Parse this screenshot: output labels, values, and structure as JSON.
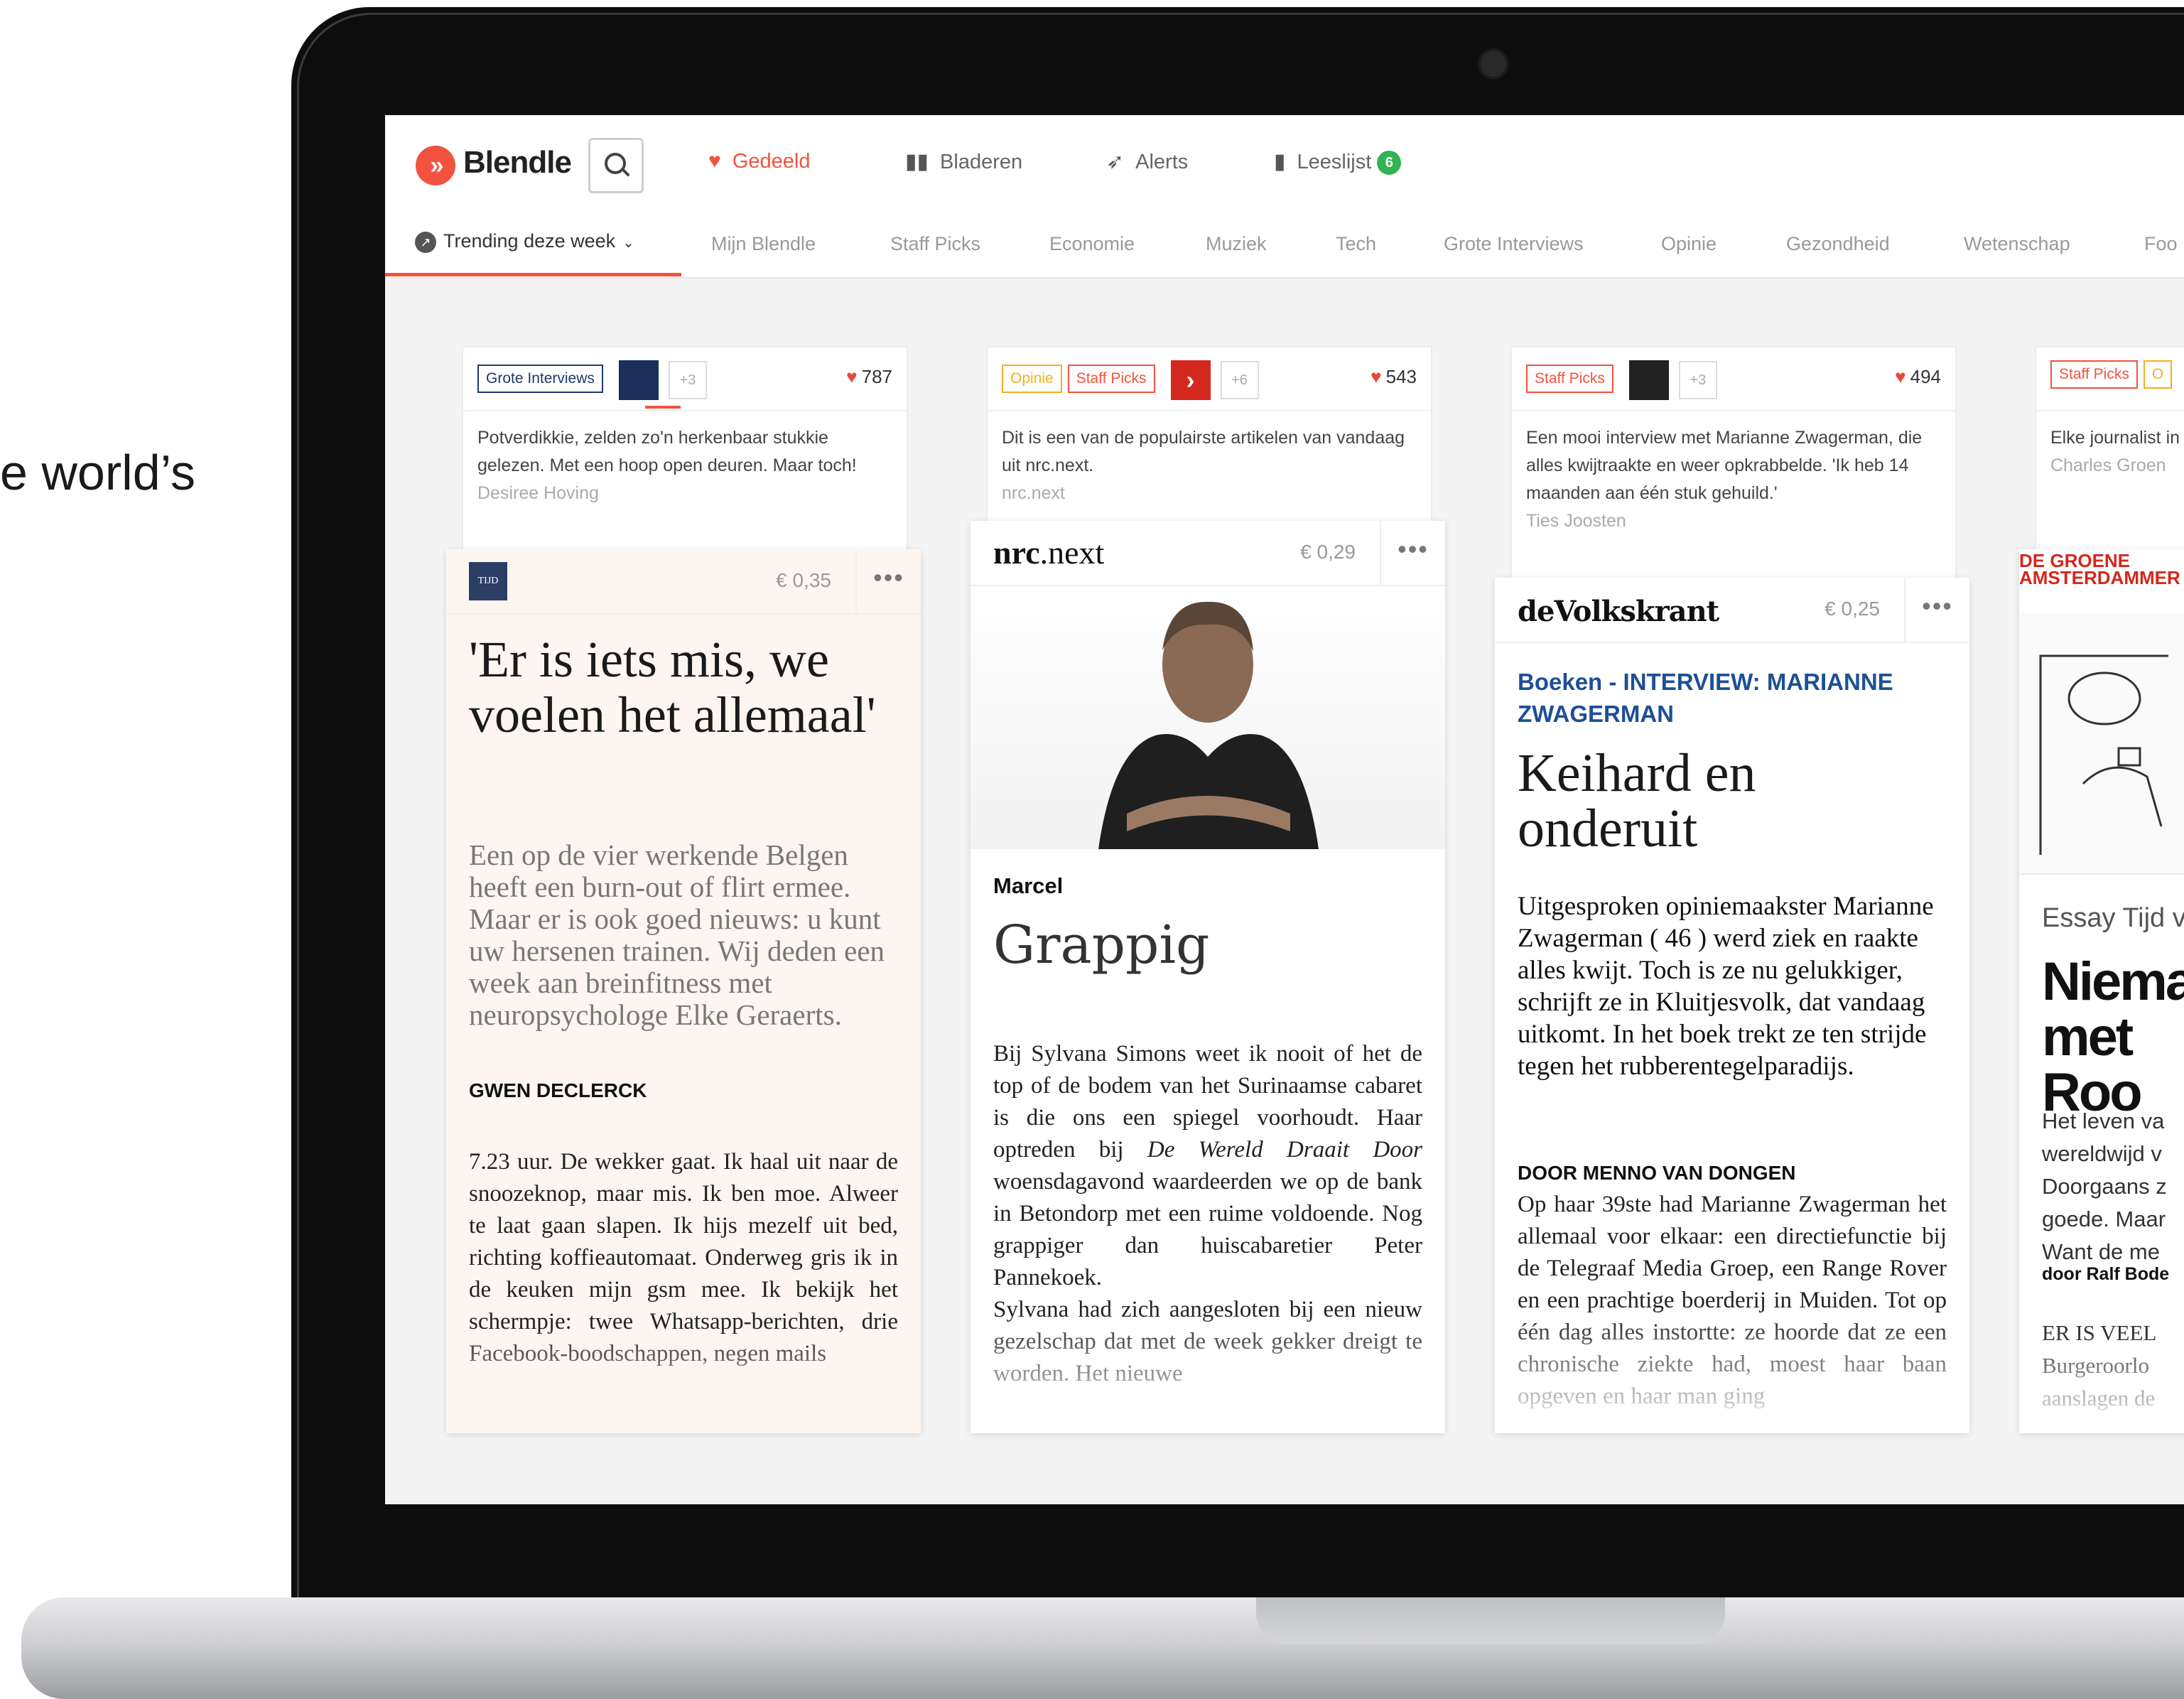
{
  "marketing": {
    "tagline_fragment": "e world’s"
  },
  "app": {
    "logo_text": "Blendle",
    "nav": [
      {
        "label": "Gedeeld",
        "icon": "heart-icon"
      },
      {
        "label": "Bladeren",
        "icon": "book-icon"
      },
      {
        "label": "Alerts",
        "icon": "alert-icon"
      },
      {
        "label": "Leeslijst",
        "icon": "bookmark-icon",
        "badge": "6"
      }
    ],
    "subnav_active": "Trending deze week",
    "subnav": [
      "Mijn Blendle",
      "Staff Picks",
      "Economie",
      "Muziek",
      "Tech",
      "Grote Interviews",
      "Opinie",
      "Gezondheid",
      "Wetenschap",
      "Foo"
    ]
  },
  "cards": [
    {
      "tags": [
        "Grote Interviews"
      ],
      "plus": "+3",
      "likes": "787",
      "snippet": "Potverdikkie, zelden zo'n herkenbaar stukkie gelezen. Met een hoop open deuren. Maar toch!",
      "snippet_author": "Desiree Hoving",
      "publisher": "TIJD",
      "price": "€ 0,35",
      "title": "'Er is iets mis, we voelen het allemaal'",
      "lead": "Een op de vier werkende Belgen heeft een burn-out of flirt ermee. Maar er is ook goed nieuws: u kunt uw hersenen trainen. Wij deden een week aan breinfitness met neuropsychologe Elke Geraerts.",
      "byline": "GWEN DECLERCK",
      "body": "7.23 uur. De wekker gaat. Ik haal uit naar de snoozeknop, maar mis. Ik ben moe. Alweer te laat gaan slapen. Ik hijs mezelf uit bed, richting koffieautomaat. Onderweg gris ik in de keuken mijn gsm mee. Ik bekijk het schermpje: twee Whatsapp-berichten, drie Facebook-boodschappen, negen mails"
    },
    {
      "tags": [
        "Opinie",
        "Staff Picks"
      ],
      "plus": "+6",
      "likes": "543",
      "snippet": "Dit is een van de populairste artikelen van vandaag uit nrc.next.",
      "snippet_author": "nrc.next",
      "publisher_bold": "nrc",
      "publisher_rest": ".next",
      "price": "€ 0,29",
      "kicker": "Marcel",
      "title": "Grappig",
      "body1": "Bij Sylvana Simons weet ik nooit of het de top of de bodem van het Surinaamse cabaret is die ons een spiegel voorhoudt. Haar optreden bij",
      "body_italic": "De Wereld Draait Door",
      "body2": " woensdagavond waardeerden we op de bank in Betondorp met een ruime voldoende. Nog grappiger dan huiscabaretier Peter Pannekoek.",
      "body3": "Sylvana had zich aangesloten bij een nieuw gezelschap dat met de week gekker dreigt te worden. Het nieuwe"
    },
    {
      "tags": [
        "Staff Picks"
      ],
      "plus": "+3",
      "likes": "494",
      "snippet": "Een mooi interview met Marianne Zwagerman, die alles kwijtraakte en weer opkrabbelde. 'Ik heb 14 maanden aan één stuk gehuild.'",
      "snippet_author": "Ties Joosten",
      "publisher": "deVolkskrant",
      "price": "€ 0,25",
      "kicker": "Boeken - INTERVIEW: MARIANNE ZWAGERMAN",
      "title": "Keihard en onderuit",
      "lead": "Uitgesproken opiniemaakster Marianne Zwagerman ( 46 ) werd ziek en raakte alles kwijt. Toch is ze nu gelukkiger, schrijft ze in Kluitjesvolk, dat vandaag uitkomt. In het boek trekt ze ten strijde tegen het rubberentegelparadijs.",
      "byline": "DOOR MENNO VAN DONGEN",
      "body": "Op haar 39ste had Marianne Zwagerman het allemaal voor elkaar: een directiefunctie bij de Telegraaf Media Groep, een Range Rover en een prachtige boerderij in Muiden. Tot op één dag alles instortte: ze hoorde dat ze een chronische ziekte had, moest haar baan opgeven en haar man ging"
    },
    {
      "tags": [
        "Staff Picks",
        "O"
      ],
      "snippet": "Elke journalist in een hoekje schamen. Jou",
      "snippet_author": "Charles Groen",
      "publisher": "DE GROENE AMSTERDAMMER",
      "kicker": "Essay Tijd v",
      "title": "Nieman met Roo",
      "body": "Het leven va wereldwijd v Doorgaans z goede. Maar Want de me",
      "byline": "door Ralf Bode",
      "body2": "ER IS VEEL Burgeroorlo aanslagen de"
    }
  ]
}
